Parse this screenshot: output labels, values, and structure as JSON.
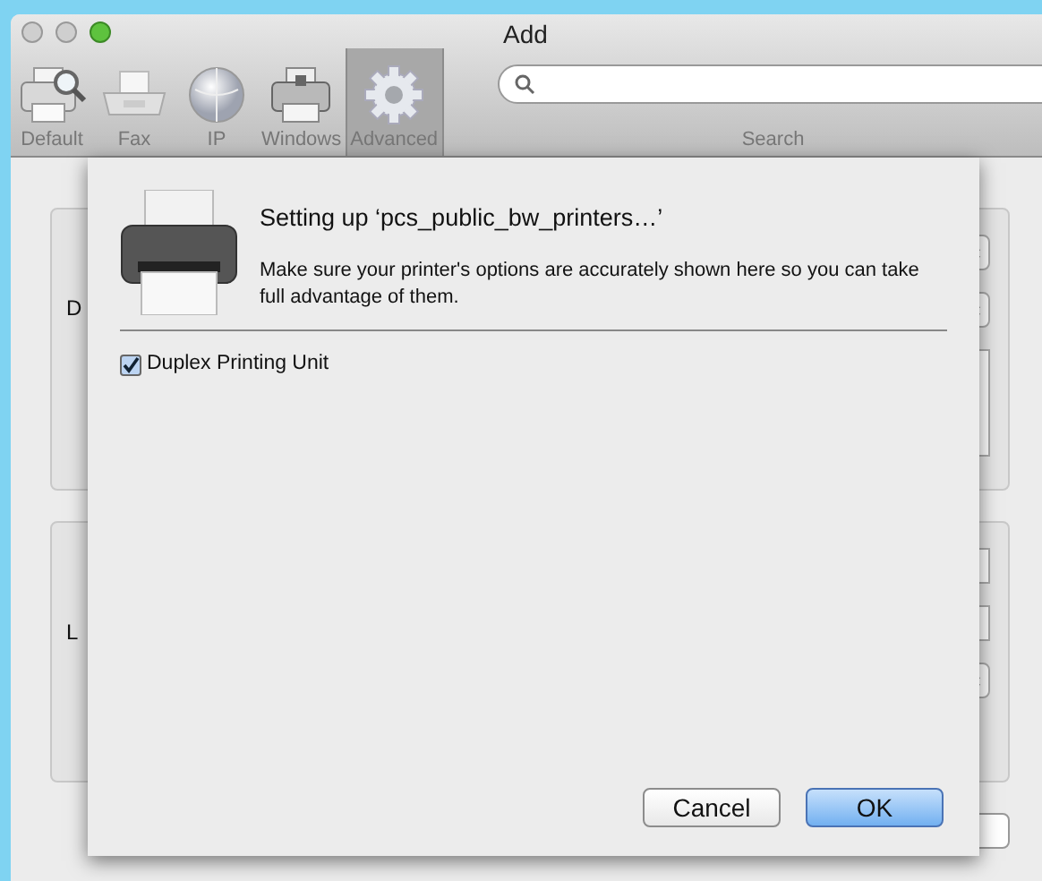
{
  "window": {
    "title": "Add"
  },
  "toolbar": [
    {
      "label": "Default",
      "kind": "default",
      "selected": false
    },
    {
      "label": "Fax",
      "kind": "fax",
      "selected": false
    },
    {
      "label": "IP",
      "kind": "ip",
      "selected": false
    },
    {
      "label": "Windows",
      "kind": "windows",
      "selected": false
    },
    {
      "label": "Advanced",
      "kind": "advanced",
      "selected": true
    }
  ],
  "search": {
    "label": "Search"
  },
  "device_box": {
    "label": "D",
    "rows": [
      {
        "kind": "popup"
      },
      {
        "kind": "popup"
      },
      {
        "kind": "area"
      }
    ]
  },
  "printer_box": {
    "label": "L",
    "rows": [
      {
        "kind": "field"
      },
      {
        "kind": "field"
      },
      {
        "kind": "popup"
      }
    ]
  },
  "sheet": {
    "title": "Setting up ‘pcs_public_bw_printers…’",
    "message": "Make sure your printer's options are accurately shown here so you can take full advantage of them.",
    "options": [
      {
        "label": "Duplex Printing Unit",
        "checked": true
      }
    ],
    "buttons": [
      {
        "label": "Cancel",
        "default": false
      },
      {
        "label": "OK",
        "default": true
      }
    ]
  }
}
